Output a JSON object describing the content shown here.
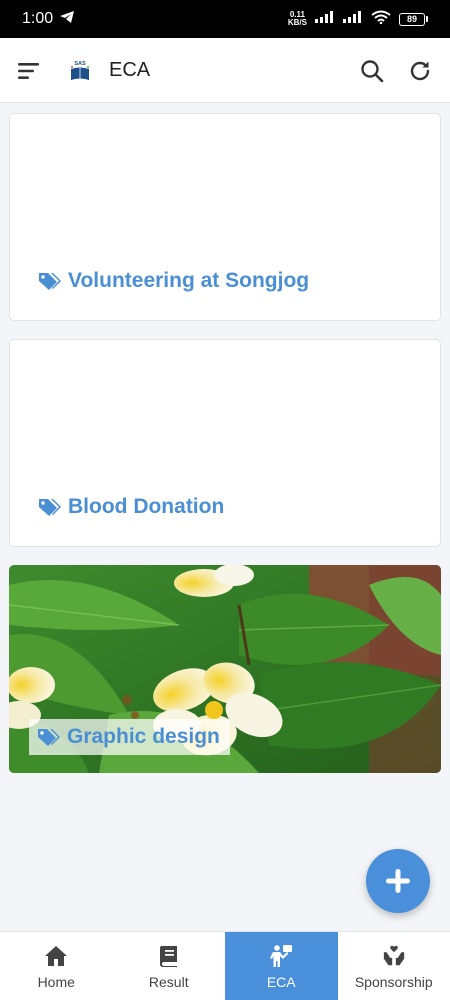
{
  "status_bar": {
    "time": "1:00",
    "net_speed_value": "0.11",
    "net_speed_unit": "KB/S",
    "battery": "89"
  },
  "app_bar": {
    "logo_text": "SAS",
    "title": "ECA"
  },
  "cards": [
    {
      "label": "Volunteering at Songjog",
      "icon": "tag-icon",
      "has_image": false
    },
    {
      "label": "Blood Donation",
      "icon": "tag-icon",
      "has_image": false
    },
    {
      "label": "Graphic design",
      "icon": "tag-icon",
      "has_image": true
    }
  ],
  "fab": {
    "icon": "plus-icon"
  },
  "bottom_nav": {
    "items": [
      {
        "label": "Home",
        "icon": "home-icon"
      },
      {
        "label": "Result",
        "icon": "book-icon"
      },
      {
        "label": "ECA",
        "icon": "person-presenting-icon",
        "active": true
      },
      {
        "label": "Sponsorship",
        "icon": "hands-donate-icon"
      }
    ]
  },
  "colors": {
    "accent": "#4a8fd9",
    "label_text": "#4a8fd4",
    "background": "#f4f5f8"
  }
}
